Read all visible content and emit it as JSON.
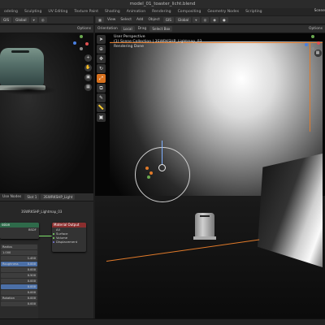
{
  "window": {
    "title": "model_01_toaster_licht.blend"
  },
  "workspace_tabs": [
    "odeling",
    "Sculpting",
    "UV Editing",
    "Texture Paint",
    "Shading",
    "Animation",
    "Rendering",
    "Compositing",
    "Geometry Nodes",
    "Scripting"
  ],
  "scene_label": "Scene",
  "left_viewport": {
    "header": {
      "gis": "GIS",
      "orientation": "Global",
      "options": "Options"
    }
  },
  "main_viewport": {
    "header": {
      "orientation_label": "Orientation",
      "orientation_value": "Local",
      "drag_label": "Drag",
      "drag_value": "Select Box",
      "options": "Options",
      "menu": [
        "View",
        "Select",
        "Add",
        "Object"
      ],
      "gis": "GIS",
      "global": "Global"
    },
    "info": {
      "line1": "User Perspective",
      "line2": "(1) Scene Collection | 3SWRKSHP_Lightmap_03",
      "line3": "Rendering Done"
    }
  },
  "node_editor": {
    "header": {
      "use_nodes": "Use Nodes",
      "slot": "Slot 1",
      "material": "3SWRKSHP_Light"
    },
    "breadcrumb": "3SWRKSHP_Lightmap_03",
    "nodes": {
      "material_output": {
        "title": "Material Output",
        "target": "All",
        "sockets": [
          "Surface",
          "Volume",
          "Displacement"
        ]
      },
      "emission": {
        "title": "ssion",
        "socket": "BSDF"
      }
    }
  },
  "properties": {
    "rows": [
      {
        "label": "Radius",
        "value": ""
      },
      {
        "label": "1.000",
        "value": ""
      },
      {
        "label": "",
        "value": "1.450"
      },
      {
        "label": "Roughness",
        "value": "0.000"
      },
      {
        "label": "",
        "value": "0.000"
      },
      {
        "label": "",
        "value": "0.500"
      },
      {
        "label": "",
        "value": "0.000"
      },
      {
        "label": "",
        "value": "0.000"
      },
      {
        "label": "",
        "value": "0.000"
      },
      {
        "label": "Rotation",
        "value": "0.000"
      },
      {
        "label": "",
        "value": "0.000"
      }
    ]
  },
  "colors": {
    "accent": "#d7711e",
    "selection_box": "#e07a2a",
    "socket_green": "#7ee06a",
    "node_output_header": "#8a2e2e",
    "node_shader_header": "#2e6a4a"
  }
}
